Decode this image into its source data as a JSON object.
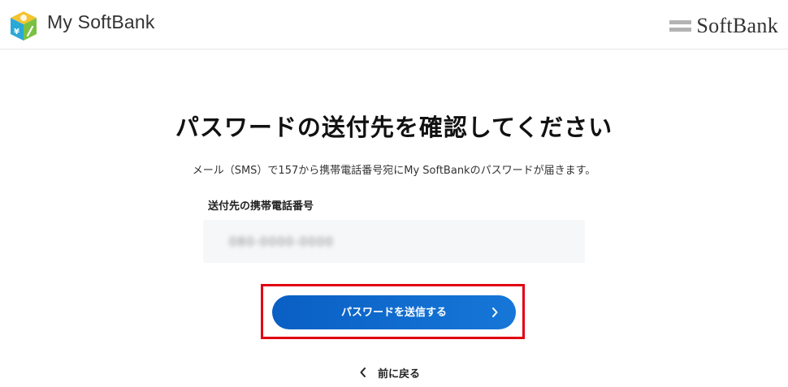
{
  "header": {
    "app_name": "My SoftBank",
    "app_logo_icon": "my-softbank-cube-icon",
    "brand_name": "SoftBank",
    "brand_mark_icon": "softbank-double-bar-icon"
  },
  "main": {
    "title": "パスワードの送付先を確認してください",
    "description": "メール（SMS）で157から携帯電話番号宛にMy SoftBankのパスワードが届きます。",
    "phone_field": {
      "label": "送付先の携帯電話番号",
      "value": "080-0000-0000"
    },
    "send_button": {
      "label": "パスワードを送信する",
      "icon": "chevron-right-icon"
    },
    "back_link": {
      "label": "前に戻る",
      "icon": "chevron-left-icon"
    }
  },
  "colors": {
    "button_blue": "#0a5fc4",
    "highlight_red": "#e10012",
    "field_background": "#f6f7f9"
  }
}
